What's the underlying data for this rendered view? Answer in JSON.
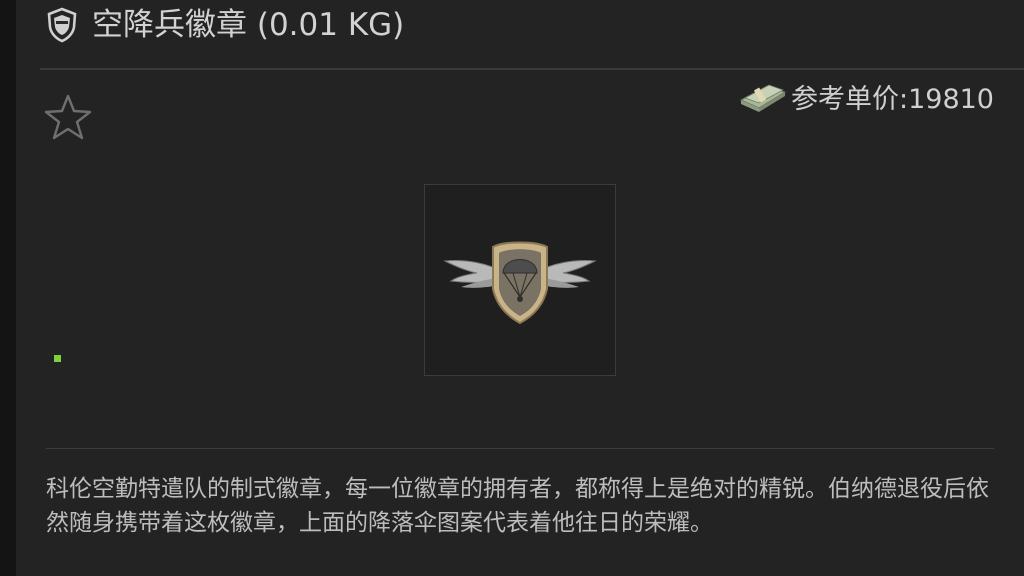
{
  "header": {
    "title": "空降兵徽章 (0.01 KG)",
    "icon": "shield-badge-icon"
  },
  "favorite": {
    "icon": "star-outline-icon"
  },
  "price": {
    "icon": "cash-stack-icon",
    "text": "参考单价:19810"
  },
  "item": {
    "image": "paratrooper-badge-image"
  },
  "status": {
    "indicator_color": "#7fd13b"
  },
  "description": {
    "text": "科伦空勤特遣队的制式徽章，每一位徽章的拥有者，都称得上是绝对的精锐。伯纳德退役后依然随身携带着这枚徽章，上面的降落伞图案代表着他往日的荣耀。"
  }
}
